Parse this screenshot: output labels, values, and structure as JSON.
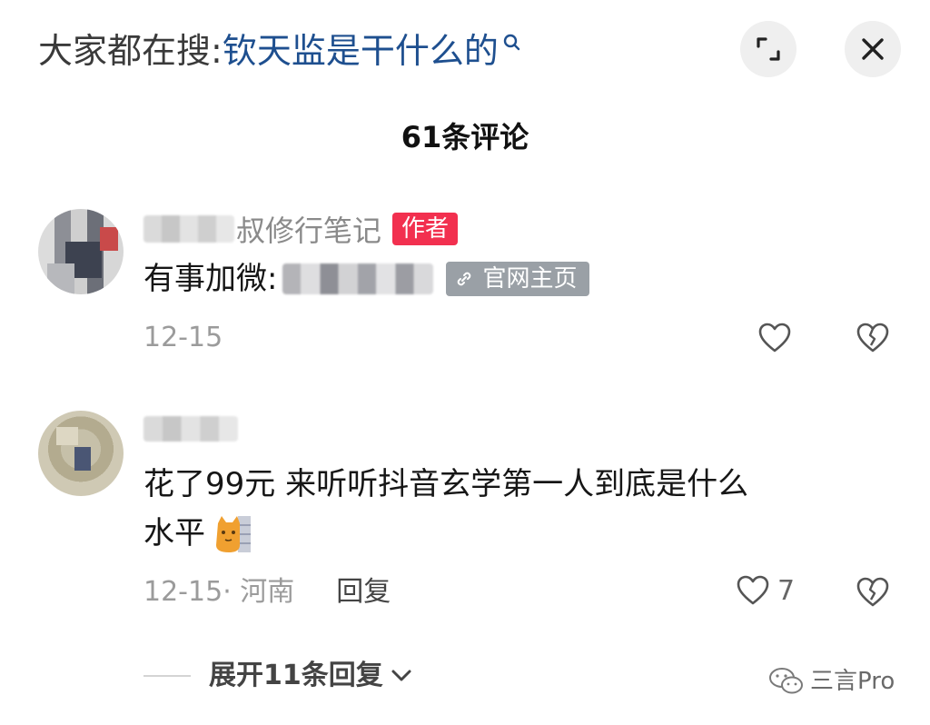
{
  "search": {
    "prefix": "大家都在搜:",
    "query": "钦天监是干什么的"
  },
  "header": {
    "comment_count": "61条评论"
  },
  "comments": [
    {
      "username": "叔修行笔记",
      "author_badge": "作者",
      "text": "有事加微:",
      "link_badge": "官网主页",
      "date": "12-15"
    },
    {
      "text_line1": "花了99元  来听听抖音玄学第一人到底是什么",
      "text_line2": "水平",
      "date": "12-15",
      "location": "· 河南",
      "reply_label": "回复",
      "like_count": "7"
    }
  ],
  "expand": {
    "label": "展开11条回复"
  },
  "watermark": {
    "text": "三言Pro"
  },
  "icons": {
    "search": "search-icon",
    "expand": "expand-icon",
    "close": "close-icon",
    "like": "heart-icon",
    "dislike": "broken-heart-icon",
    "link": "link-icon",
    "chevron": "chevron-down-icon",
    "emoji": "cat-emoji"
  },
  "colors": {
    "search_link": "#1e4f8f",
    "author_badge": "#f2304f",
    "link_badge": "#9aa0a6",
    "meta_text": "#9b9b9b"
  }
}
